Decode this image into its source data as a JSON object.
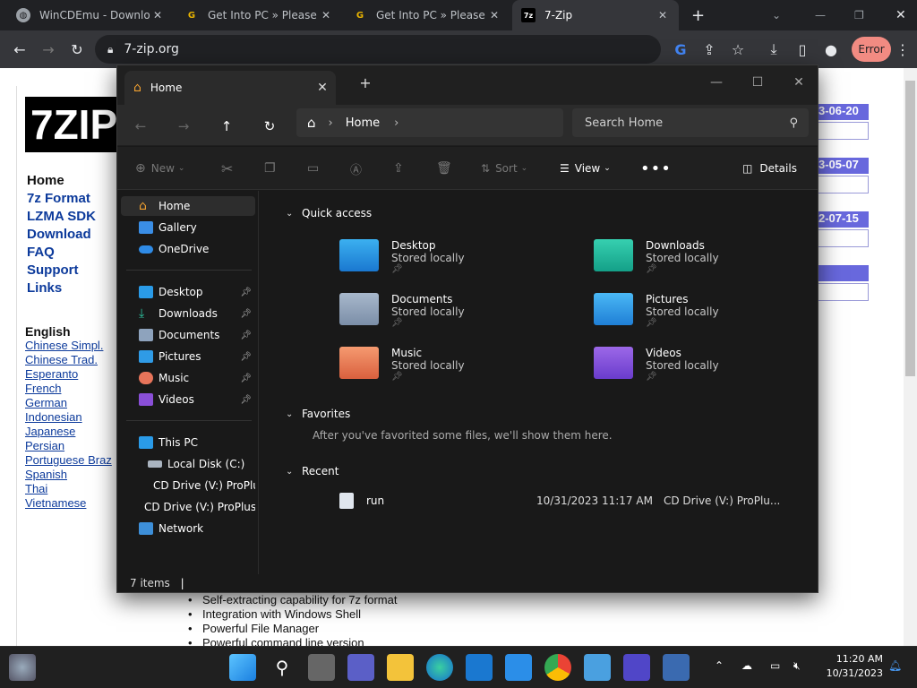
{
  "browser": {
    "tabs": [
      {
        "title": "WinCDEmu - Download"
      },
      {
        "title": "Get Into PC » Please W"
      },
      {
        "title": "Get Into PC » Please W"
      },
      {
        "title": "7-Zip"
      }
    ],
    "new_tab_icon": "plus-icon",
    "url": "7-zip.org",
    "error_label": "Error"
  },
  "page": {
    "logo_text": "7ZIP",
    "nav": [
      "Home",
      "7z Format",
      "LZMA SDK",
      "Download",
      "FAQ",
      "Support",
      "Links"
    ],
    "lang_heading": "English",
    "languages": [
      "Chinese Simpl.",
      "Chinese Trad.",
      "Esperanto",
      "French",
      "German",
      "Indonesian",
      "Japanese",
      "Persian",
      "Portuguese Braz",
      "Spanish",
      "Thai",
      "Vietnamese"
    ],
    "dates": [
      "3-06-20",
      "3-05-07",
      "2-07-15"
    ],
    "bullets": [
      "Self-extracting capability for 7z format",
      "Integration with Windows Shell",
      "Powerful File Manager",
      "Powerful command line version"
    ]
  },
  "explorer": {
    "tab_title": "Home",
    "breadcrumb": "Home",
    "search_placeholder": "Search Home",
    "cmd": {
      "new": "New",
      "sort": "Sort",
      "view": "View",
      "details": "Details"
    },
    "sidebar": {
      "top": [
        {
          "label": "Home"
        },
        {
          "label": "Gallery"
        },
        {
          "label": "OneDrive"
        }
      ],
      "pinned": [
        {
          "label": "Desktop"
        },
        {
          "label": "Downloads"
        },
        {
          "label": "Documents"
        },
        {
          "label": "Pictures"
        },
        {
          "label": "Music"
        },
        {
          "label": "Videos"
        }
      ],
      "pc": [
        {
          "label": "This PC"
        },
        {
          "label": "Local Disk (C:)"
        },
        {
          "label": "CD Drive (V:) ProPlu"
        },
        {
          "label": "CD Drive (V:) ProPlus"
        },
        {
          "label": "Network"
        }
      ]
    },
    "quick_access_title": "Quick access",
    "quick_access": [
      {
        "name": "Desktop",
        "sub": "Stored locally"
      },
      {
        "name": "Downloads",
        "sub": "Stored locally"
      },
      {
        "name": "Documents",
        "sub": "Stored locally"
      },
      {
        "name": "Pictures",
        "sub": "Stored locally"
      },
      {
        "name": "Music",
        "sub": "Stored locally"
      },
      {
        "name": "Videos",
        "sub": "Stored locally"
      }
    ],
    "favorites_title": "Favorites",
    "favorites_empty": "After you've favorited some files, we'll show them here.",
    "recent_title": "Recent",
    "recent": [
      {
        "name": "run",
        "date": "10/31/2023 11:17 AM",
        "location": "CD Drive (V:) ProPlu..."
      }
    ],
    "status": "7 items"
  },
  "taskbar": {
    "time": "11:20 AM",
    "date": "10/31/2023"
  },
  "colors": {
    "accent_blue": "#0c3a9b",
    "date_bar": "#6868dd",
    "error_pill": "#f28b82"
  }
}
